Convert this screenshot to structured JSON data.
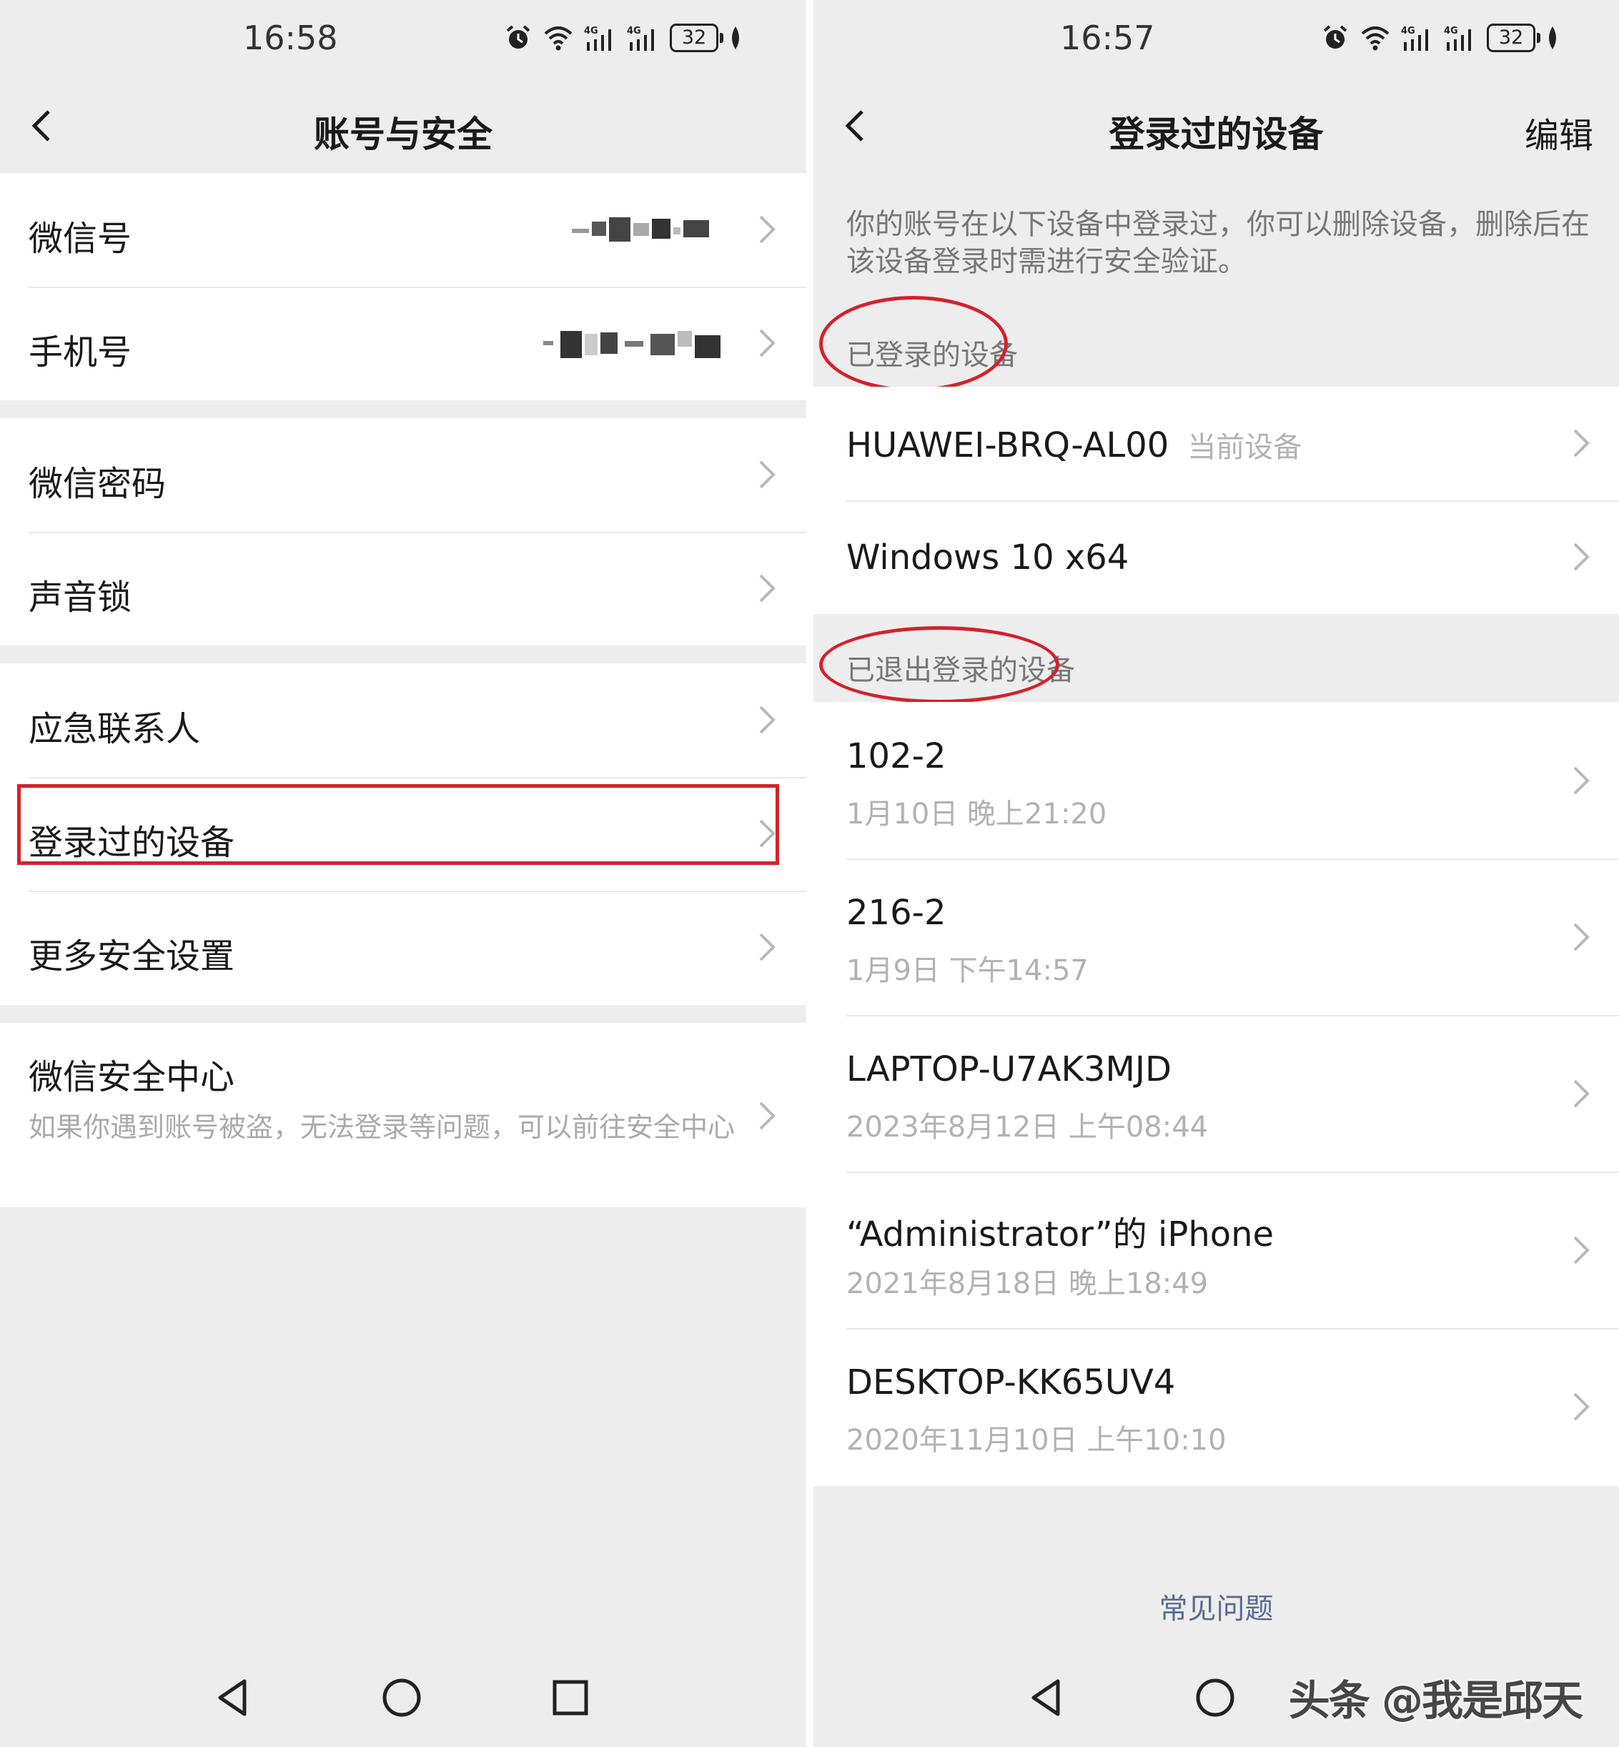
{
  "left": {
    "status_time": "16:58",
    "battery": "32",
    "title": "账号与安全",
    "rows": {
      "wechat_id": "微信号",
      "phone": "手机号",
      "password": "微信密码",
      "voice_lock": "声音锁",
      "emergency": "应急联系人",
      "devices": "登录过的设备",
      "more_security": "更多安全设置",
      "security_center": "微信安全中心",
      "security_center_desc": "如果你遇到账号被盗，无法登录等问题，可以前往安全中心"
    }
  },
  "right": {
    "status_time": "16:57",
    "battery": "32",
    "title": "登录过的设备",
    "edit": "编辑",
    "info": "你的账号在以下设备中登录过，你可以删除设备，删除后在该设备登录时需进行安全验证。",
    "logged_in_title": "已登录的设备",
    "logged_in": [
      {
        "name": "HUAWEI-BRQ-AL00",
        "tag": "当前设备"
      },
      {
        "name": "Windows 10 x64"
      }
    ],
    "logged_out_title": "已退出登录的设备",
    "logged_out": [
      {
        "name": "102-2",
        "time": "1月10日 晚上21:20"
      },
      {
        "name": "216-2",
        "time": "1月9日 下午14:57"
      },
      {
        "name": "LAPTOP-U7AK3MJD",
        "time": "2023年8月12日 上午08:44"
      },
      {
        "name": "“Administrator”的 iPhone",
        "time": "2021年8月18日 晚上18:49"
      },
      {
        "name": "DESKTOP-KK65UV4",
        "time": "2020年11月10日 上午10:10"
      }
    ],
    "faq": "常见问题"
  },
  "watermark": "头条 @我是邱天",
  "colors": {
    "background": "#ededed",
    "card": "#ffffff",
    "highlight_red": "#d3222c",
    "link_blue": "#576b95",
    "secondary_text": "#b2b2b2"
  }
}
